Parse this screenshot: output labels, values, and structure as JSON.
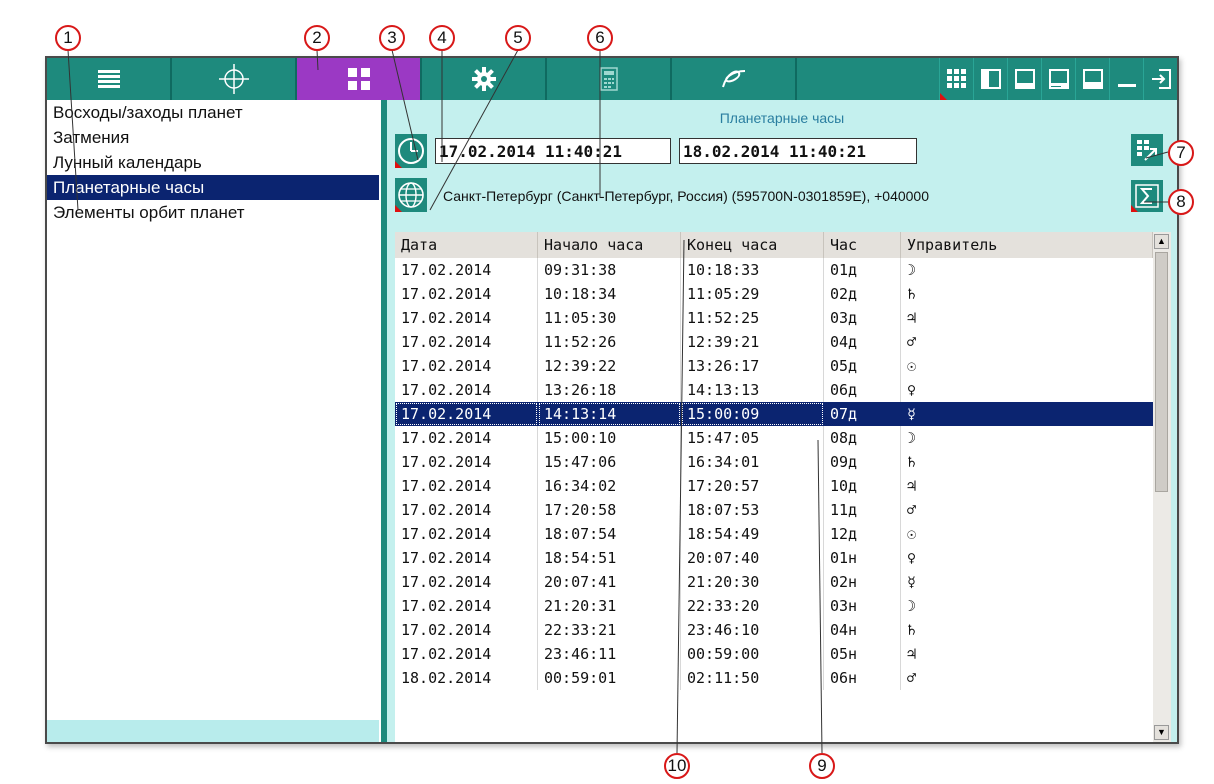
{
  "callouts": [
    "1",
    "2",
    "3",
    "4",
    "5",
    "6",
    "7",
    "8",
    "9",
    "10"
  ],
  "sidebar": {
    "items": [
      {
        "label": "Восходы/заходы планет"
      },
      {
        "label": "Затмения"
      },
      {
        "label": "Лунный календарь"
      },
      {
        "label": "Планетарные часы",
        "selected": true
      },
      {
        "label": "Элементы орбит планет"
      }
    ]
  },
  "panel": {
    "title": "Планетарные часы",
    "start_datetime": "17.02.2014 11:40:21",
    "end_datetime": "18.02.2014 11:40:21",
    "location": "Санкт-Петербург (Санкт-Петербург, Россия) (595700N-0301859E), +040000"
  },
  "table": {
    "headers": [
      "Дата",
      "Начало часа",
      "Конец часа",
      "Час",
      "Управитель"
    ],
    "rows": [
      [
        "17.02.2014",
        "09:31:38",
        "10:18:33",
        "01д",
        "☽"
      ],
      [
        "17.02.2014",
        "10:18:34",
        "11:05:29",
        "02д",
        "♄"
      ],
      [
        "17.02.2014",
        "11:05:30",
        "11:52:25",
        "03д",
        "♃"
      ],
      [
        "17.02.2014",
        "11:52:26",
        "12:39:21",
        "04д",
        "♂"
      ],
      [
        "17.02.2014",
        "12:39:22",
        "13:26:17",
        "05д",
        "☉"
      ],
      [
        "17.02.2014",
        "13:26:18",
        "14:13:13",
        "06д",
        "♀"
      ],
      [
        "17.02.2014",
        "14:13:14",
        "15:00:09",
        "07д",
        "☿"
      ],
      [
        "17.02.2014",
        "15:00:10",
        "15:47:05",
        "08д",
        "☽"
      ],
      [
        "17.02.2014",
        "15:47:06",
        "16:34:01",
        "09д",
        "♄"
      ],
      [
        "17.02.2014",
        "16:34:02",
        "17:20:57",
        "10д",
        "♃"
      ],
      [
        "17.02.2014",
        "17:20:58",
        "18:07:53",
        "11д",
        "♂"
      ],
      [
        "17.02.2014",
        "18:07:54",
        "18:54:49",
        "12д",
        "☉"
      ],
      [
        "17.02.2014",
        "18:54:51",
        "20:07:40",
        "01н",
        "♀"
      ],
      [
        "17.02.2014",
        "20:07:41",
        "21:20:30",
        "02н",
        "☿"
      ],
      [
        "17.02.2014",
        "21:20:31",
        "22:33:20",
        "03н",
        "☽"
      ],
      [
        "17.02.2014",
        "22:33:21",
        "23:46:10",
        "04н",
        "♄"
      ],
      [
        "17.02.2014",
        "23:46:11",
        "00:59:00",
        "05н",
        "♃"
      ],
      [
        "18.02.2014",
        "00:59:01",
        "02:11:50",
        "06н",
        "♂"
      ]
    ],
    "selected_row": 6
  },
  "colors": {
    "toolbar": "#1e8a7d",
    "active_tab": "#9b39c4",
    "selection": "#0b2470",
    "panel_bg": "#c4f0ee",
    "callout": "#d81818"
  },
  "icons": {
    "toolbar": [
      "list-icon",
      "crosshair-icon",
      "grid-icon",
      "gear-icon",
      "calculator-icon",
      "signature-icon"
    ],
    "window": [
      "grid-layout-icon",
      "left-panel-icon",
      "bottom-panel-icon",
      "right-panel-icon",
      "wide-panel-icon",
      "minimize-icon",
      "exit-icon"
    ]
  }
}
